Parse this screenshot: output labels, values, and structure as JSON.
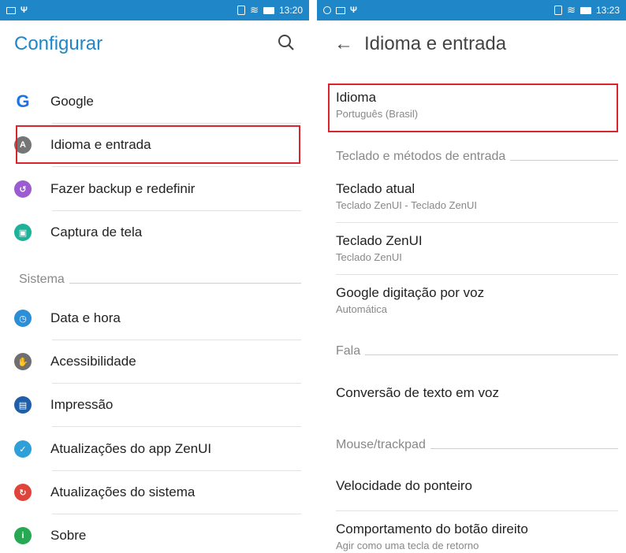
{
  "left": {
    "status_time": "13:20",
    "title": "Configurar",
    "items": [
      {
        "label": "Google",
        "color": "#1a73e8",
        "glyph": "G"
      },
      {
        "label": "Idioma e entrada",
        "color": "#757575",
        "glyph": "A"
      },
      {
        "label": "Fazer backup e redefinir",
        "color": "#9c5bd1",
        "glyph": "↺"
      },
      {
        "label": "Captura de tela",
        "color": "#1fb29a",
        "glyph": "▣"
      }
    ],
    "section_sistema": "Sistema",
    "system_items": [
      {
        "label": "Data e hora",
        "color": "#2c8ed6",
        "glyph": "◷"
      },
      {
        "label": "Acessibilidade",
        "color": "#6f6f6f",
        "glyph": "✋"
      },
      {
        "label": "Impressão",
        "color": "#1f5fa8",
        "glyph": "▤"
      },
      {
        "label": "Atualizações do app ZenUI",
        "color": "#2f9fd8",
        "glyph": "✓"
      },
      {
        "label": "Atualizações do sistema",
        "color": "#e0433a",
        "glyph": "↻"
      },
      {
        "label": "Sobre",
        "color": "#27a852",
        "glyph": "i"
      }
    ]
  },
  "right": {
    "status_time": "13:23",
    "title": "Idioma e entrada",
    "idioma": {
      "title": "Idioma",
      "subtitle": "Português (Brasil)"
    },
    "section_teclado": "Teclado e métodos de entrada",
    "teclado_atual": {
      "title": "Teclado atual",
      "subtitle": "Teclado ZenUI - Teclado ZenUI"
    },
    "teclado_zenui": {
      "title": "Teclado ZenUI",
      "subtitle": "Teclado ZenUI"
    },
    "google_voz": {
      "title": "Google digitação por voz",
      "subtitle": "Automática"
    },
    "section_fala": "Fala",
    "conversao": {
      "title": "Conversão de texto em voz"
    },
    "section_mouse": "Mouse/trackpad",
    "velocidade": {
      "title": "Velocidade do ponteiro"
    },
    "comportamento": {
      "title": "Comportamento do botão direito",
      "subtitle": "Agir como uma tecla de retorno"
    }
  },
  "colors": {
    "statusbar": "#1f86c7",
    "accent": "#1f86c7",
    "highlight": "#d9232e"
  }
}
